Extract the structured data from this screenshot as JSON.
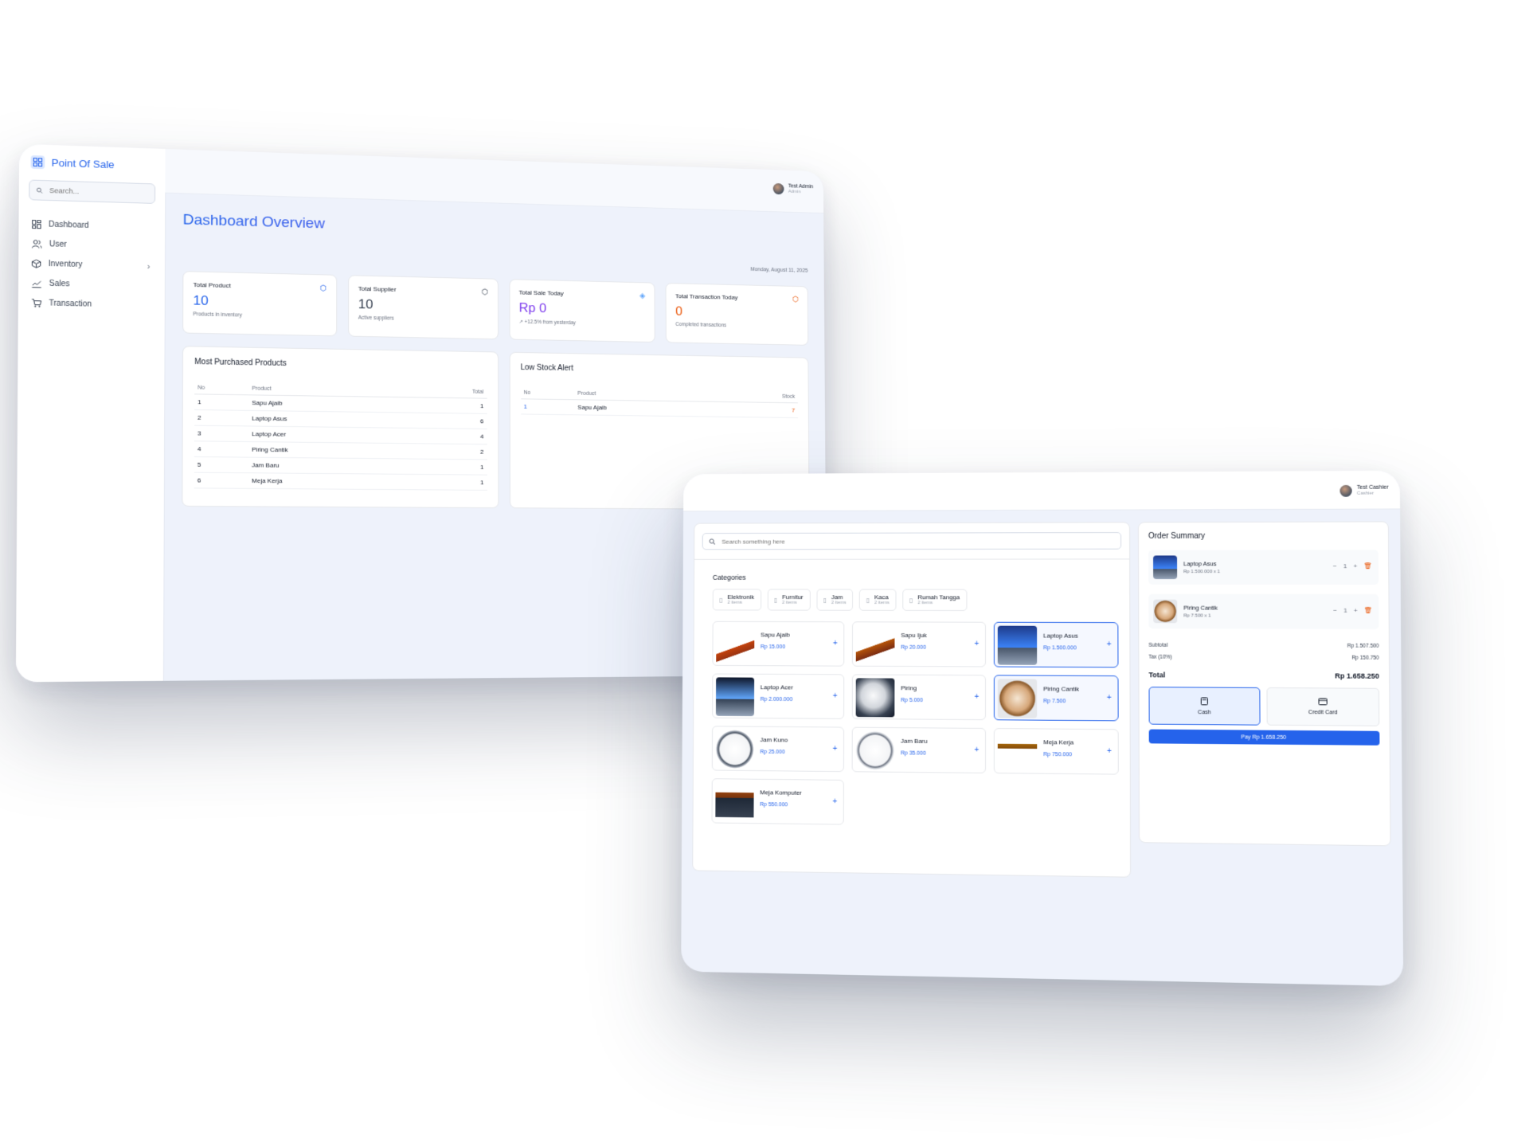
{
  "dashboard": {
    "brand": "Point Of Sale",
    "search_placeholder": "Search...",
    "nav": [
      {
        "label": "Dashboard",
        "icon": "grid-icon"
      },
      {
        "label": "User",
        "icon": "users-icon"
      },
      {
        "label": "Inventory",
        "icon": "box-icon",
        "has_chevron": true
      },
      {
        "label": "Sales",
        "icon": "chart-icon"
      },
      {
        "label": "Transaction",
        "icon": "cart-icon"
      }
    ],
    "user": {
      "name": "Test Admin",
      "role": "Admin"
    },
    "title": "Dashboard Overview",
    "date": "Monday, August 11, 2025",
    "stats": [
      {
        "label": "Total Product",
        "value": "10",
        "sub": "Products in inventory",
        "color": "#2563eb",
        "icon": "box-icon"
      },
      {
        "label": "Total Supplier",
        "value": "10",
        "sub": "Active suppliers",
        "color": "#374151",
        "icon": "box-icon"
      },
      {
        "label": "Total Sale Today",
        "value": "Rp 0",
        "sub": "↗ +12.5% from yesterday",
        "color": "#7c3aed",
        "icon": "tag-icon"
      },
      {
        "label": "Total Transaction Today",
        "value": "0",
        "sub": "Completed transactions",
        "color": "#ea580c",
        "icon": "box-icon"
      }
    ],
    "most_purchased": {
      "title": "Most Purchased Products",
      "headers": [
        "No",
        "Product",
        "Total"
      ],
      "rows": [
        [
          "1",
          "Sapu Ajaib",
          "1"
        ],
        [
          "2",
          "Laptop Asus",
          "6"
        ],
        [
          "3",
          "Laptop Acer",
          "4"
        ],
        [
          "4",
          "Piring Cantik",
          "2"
        ],
        [
          "5",
          "Jam Baru",
          "1"
        ],
        [
          "6",
          "Meja Kerja",
          "1"
        ]
      ]
    },
    "low_stock": {
      "title": "Low Stock Alert",
      "headers": [
        "No",
        "Product",
        "Stock"
      ],
      "rows": [
        [
          "1",
          "Sapu Ajaib",
          "7"
        ]
      ]
    }
  },
  "pos": {
    "user": {
      "name": "Test Cashier",
      "role": "Cashier"
    },
    "search_placeholder": "Search something here",
    "categories_title": "Categories",
    "categories": [
      {
        "name": "Elektronik",
        "count": "2 items"
      },
      {
        "name": "Furnitur",
        "count": "2 items"
      },
      {
        "name": "Jam",
        "count": "2 items"
      },
      {
        "name": "Kaca",
        "count": "2 items"
      },
      {
        "name": "Rumah Tangga",
        "count": "2 items"
      }
    ],
    "products": [
      {
        "name": "Sapu Ajaib",
        "price": "Rp 15.000",
        "thumb": "broom"
      },
      {
        "name": "Sapu Ijuk",
        "price": "Rp 20.000",
        "thumb": "broom"
      },
      {
        "name": "Laptop Asus",
        "price": "Rp 1.500.000",
        "thumb": "laptop",
        "selected": true
      },
      {
        "name": "Laptop Acer",
        "price": "Rp 2.000.000",
        "thumb": "laptop"
      },
      {
        "name": "Piring",
        "price": "Rp 5.000",
        "thumb": "plate-white"
      },
      {
        "name": "Piring Cantik",
        "price": "Rp 7.500",
        "thumb": "plate-brown",
        "selected": true
      },
      {
        "name": "Jam Kuno",
        "price": "Rp 25.000",
        "thumb": "clock"
      },
      {
        "name": "Jam Baru",
        "price": "Rp 35.000",
        "thumb": "clock"
      },
      {
        "name": "Meja Kerja",
        "price": "Rp 750.000",
        "thumb": "table"
      },
      {
        "name": "Meja Komputer",
        "price": "Rp 550.000",
        "thumb": "desk"
      }
    ],
    "order": {
      "title": "Order Summary",
      "items": [
        {
          "name": "Laptop Asus",
          "sub": "Rp 1.500.000 x 1",
          "qty": "1",
          "thumb": "laptop"
        },
        {
          "name": "Piring Cantik",
          "sub": "Rp 7.500 x 1",
          "qty": "1",
          "thumb": "plate-brown"
        }
      ],
      "subtotal_label": "Subtotal",
      "subtotal": "Rp 1.507.500",
      "tax_label": "Tax (10%)",
      "tax": "Rp 150.750",
      "total_label": "Total",
      "total": "Rp 1.658.250",
      "methods": [
        {
          "label": "Cash",
          "selected": true
        },
        {
          "label": "Credit Card",
          "selected": false
        }
      ],
      "pay_label": "Pay Rp 1.658.250"
    }
  }
}
